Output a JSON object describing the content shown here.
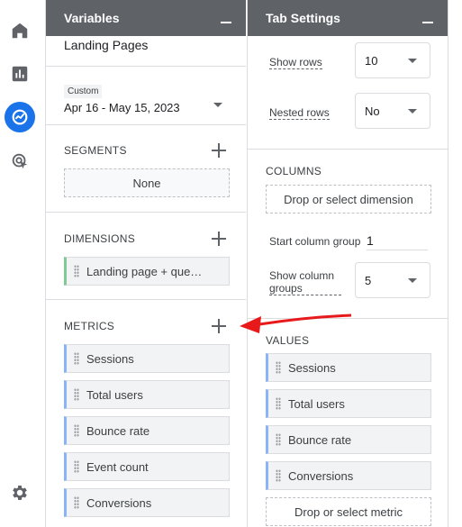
{
  "nav": {
    "icons": [
      "home-icon",
      "reports-icon",
      "explore-icon",
      "advertising-icon",
      "settings-icon"
    ],
    "accent": "#1a73e8"
  },
  "variables": {
    "title": "Variables",
    "report_name": "Landing Pages",
    "date_tag": "Custom",
    "date_range": "Apr 16 - May 15, 2023",
    "segments_title": "SEGMENTS",
    "segment_value": "None",
    "dimensions_title": "DIMENSIONS",
    "dimensions": [
      "Landing page + que…"
    ],
    "metrics_title": "METRICS",
    "metrics": [
      "Sessions",
      "Total users",
      "Bounce rate",
      "Event count",
      "Conversions"
    ]
  },
  "tab_settings": {
    "title": "Tab Settings",
    "show_rows_label": "Show rows",
    "show_rows_value": "10",
    "nested_rows_label": "Nested rows",
    "nested_rows_value": "No",
    "columns_title": "COLUMNS",
    "columns_placeholder": "Drop or select dimension",
    "start_column_group_label": "Start column group",
    "start_column_group_value": "1",
    "show_column_groups_label": "Show column groups",
    "show_column_groups_value": "5",
    "values_title": "VALUES",
    "values": [
      "Sessions",
      "Total users",
      "Bounce rate",
      "Conversions"
    ],
    "values_placeholder": "Drop or select metric"
  },
  "annotation": {
    "arrow_color": "#e8191b"
  }
}
